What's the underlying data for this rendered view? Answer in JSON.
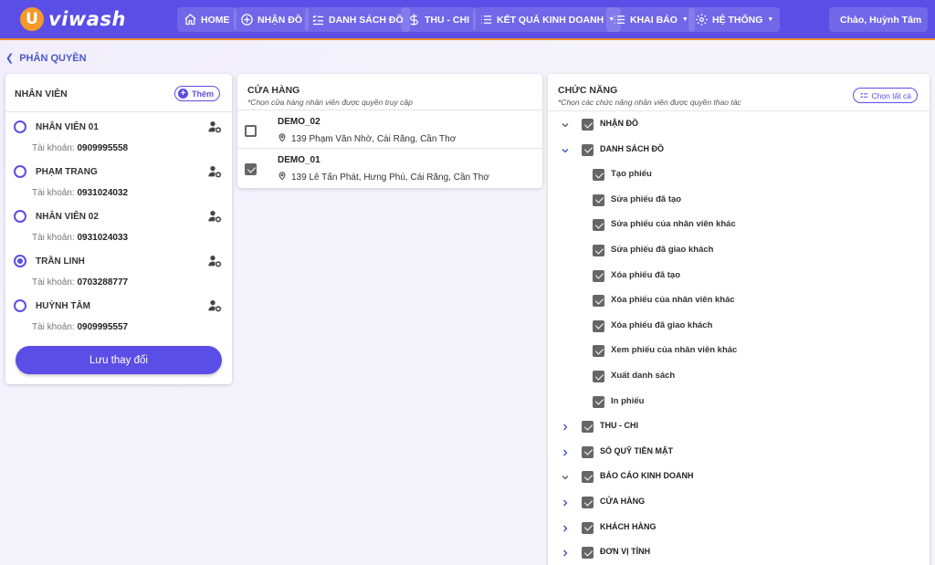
{
  "header": {
    "logo_letter": "U",
    "logo_text": "viwash",
    "nav": [
      {
        "label": "HOME"
      },
      {
        "label": "NHẬN ĐỒ"
      },
      {
        "label": "DANH SÁCH ĐỒ"
      },
      {
        "label": "THU - CHI"
      },
      {
        "label": "KẾT QUẢ KINH DOANH"
      },
      {
        "label": "KHAI BÁO"
      },
      {
        "label": "HỆ THỐNG"
      }
    ],
    "user_greeting": "Chào, Huỳnh Tâm"
  },
  "breadcrumb": {
    "label": "PHÂN QUYỀN"
  },
  "employees": {
    "title": "NHÂN VIÊN",
    "add_label": "Thêm",
    "account_prefix": "Tài khoản:",
    "items": [
      {
        "name": "NHÂN VIÊN 01",
        "account": "0909995558",
        "selected": false
      },
      {
        "name": "PHẠM TRANG",
        "account": "0931024032",
        "selected": false
      },
      {
        "name": "NHÂN VIÊN 02",
        "account": "0931024033",
        "selected": false
      },
      {
        "name": "TRẦN LINH",
        "account": "0703288777",
        "selected": true
      },
      {
        "name": "HUỲNH TÂM",
        "account": "0909995557",
        "selected": false
      }
    ],
    "save_label": "Lưu thay đổi"
  },
  "stores": {
    "title": "CỬA HÀNG",
    "subtitle": "*Chọn cửa hàng nhân viên được quyền truy cập",
    "items": [
      {
        "name": "DEMO_02",
        "address": "139 Phạm Văn Nhờ, Cái Răng, Cần Thơ",
        "checked": false
      },
      {
        "name": "DEMO_01",
        "address": "139 Lê Tấn Phát, Hưng Phú, Cái Răng, Cần Thơ",
        "checked": true
      }
    ]
  },
  "functions": {
    "title": "CHỨC NĂNG",
    "subtitle": "*Chọn các chức năng nhân viên được quyền thao tác",
    "select_all_label": "Chọn tất cả",
    "rows": [
      {
        "label": "NHẬN ĐỒ",
        "level": 0,
        "expanded": true,
        "checked": true
      },
      {
        "label": "DANH SÁCH ĐỒ",
        "level": 0,
        "expanded": true,
        "checked": true
      },
      {
        "label": "Tạo phiếu",
        "level": 1,
        "checked": true
      },
      {
        "label": "Sửa phiếu đã tạo",
        "level": 1,
        "checked": true
      },
      {
        "label": "Sửa phiếu của nhân viên khác",
        "level": 1,
        "checked": true
      },
      {
        "label": "Sửa phiếu đã giao khách",
        "level": 1,
        "checked": true
      },
      {
        "label": "Xóa phiếu đã tạo",
        "level": 1,
        "checked": true
      },
      {
        "label": "Xóa phiếu của nhân viên khác",
        "level": 1,
        "checked": true
      },
      {
        "label": "Xóa phiếu đã giao khách",
        "level": 1,
        "checked": true
      },
      {
        "label": "Xem phiếu của nhân viên khác",
        "level": 1,
        "checked": true
      },
      {
        "label": "Xuất danh sách",
        "level": 1,
        "checked": true
      },
      {
        "label": "In phiếu",
        "level": 1,
        "checked": true
      },
      {
        "label": "THU - CHI",
        "level": 0,
        "expanded": false,
        "checked": true
      },
      {
        "label": "SỔ QUỸ TIỀN MẶT",
        "level": 0,
        "expanded": false,
        "checked": true
      },
      {
        "label": "BÁO CÁO KINH DOANH",
        "level": 0,
        "expanded": true,
        "checked": true
      },
      {
        "label": "CỬA HÀNG",
        "level": 0,
        "expanded": false,
        "checked": true
      },
      {
        "label": "KHÁCH HÀNG",
        "level": 0,
        "expanded": false,
        "checked": true
      },
      {
        "label": "ĐƠN VỊ TÍNH",
        "level": 0,
        "expanded": false,
        "checked": true
      }
    ]
  },
  "colors": {
    "primary": "#5b4ee6",
    "accent": "#f39a2a",
    "link": "#4a58c9"
  }
}
